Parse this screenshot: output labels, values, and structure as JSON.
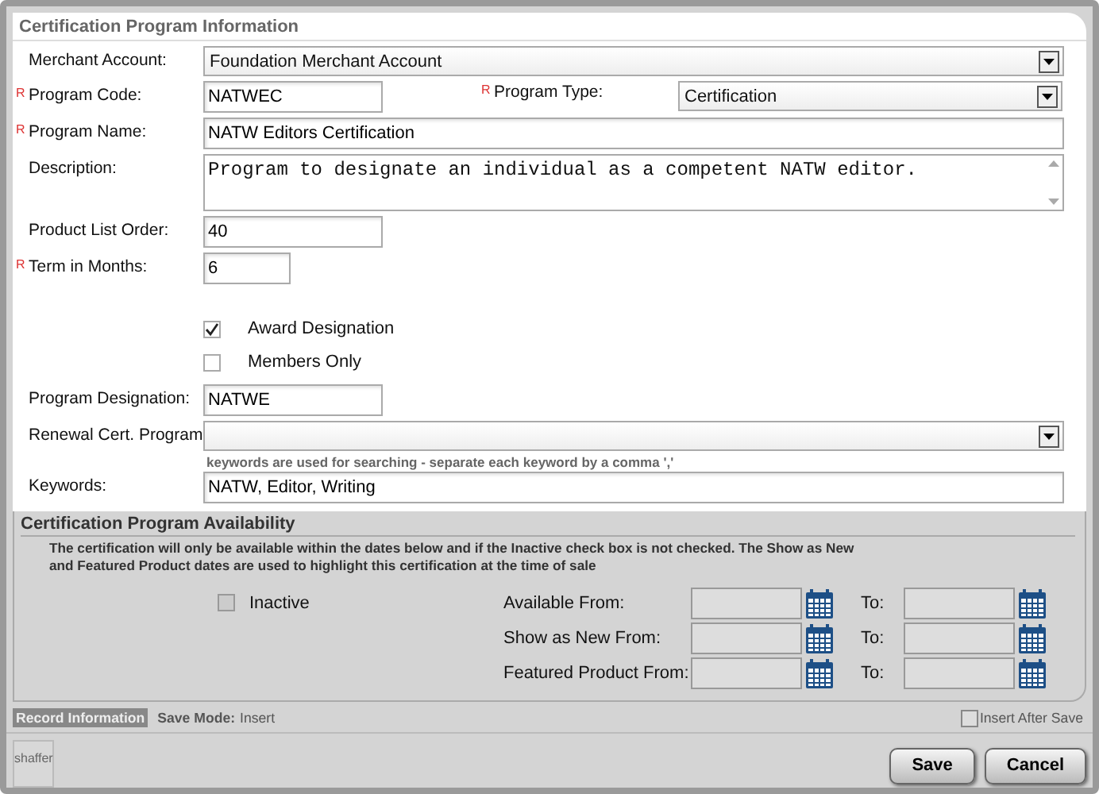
{
  "info": {
    "title": "Certification Program Information",
    "merchant_account": {
      "label": "Merchant Account:",
      "value": "Foundation Merchant Account"
    },
    "program_code": {
      "label": "Program Code:",
      "required_mark": "R",
      "value": "NATWEC"
    },
    "program_type": {
      "label": "Program Type:",
      "required_mark": "R",
      "value": "Certification"
    },
    "program_name": {
      "label": "Program Name:",
      "required_mark": "R",
      "value": "NATW Editors Certification"
    },
    "description": {
      "label": "Description:",
      "value": "Program to designate an individual as a competent NATW editor."
    },
    "product_list_order": {
      "label": "Product List Order:",
      "value": "40"
    },
    "term_in_months": {
      "label": "Term in Months:",
      "required_mark": "R",
      "value": "6"
    },
    "options": [
      {
        "label": "Award Designation",
        "checked": true
      },
      {
        "label": "Members Only",
        "checked": false
      }
    ],
    "program_designation": {
      "label": "Program Designation:",
      "value": "NATWE"
    },
    "renewal_cert_program": {
      "label": "Renewal Cert. Program"
    },
    "keywords_hint": "keywords are used for searching - separate each keyword by a comma ','",
    "keywords": {
      "label": "Keywords:",
      "value": "NATW, Editor, Writing"
    }
  },
  "availability": {
    "title": "Certification Program Availability",
    "note": "The certification will only be available within the dates below and if the Inactive check box is not checked. The Show as New and Featured Product dates are used to highlight this certification at the time of sale",
    "inactive": {
      "label": "Inactive",
      "checked": false
    },
    "date_rows": [
      {
        "label": "Available From:",
        "to_label": "To:"
      },
      {
        "label": "Show as New From:",
        "to_label": "To:"
      },
      {
        "label": "Featured Product From:",
        "to_label": "To:"
      }
    ]
  },
  "footer": {
    "record_tab": "Record Information",
    "save_mode_label": "Save Mode:",
    "save_mode_value": "Insert",
    "insert_after_save": {
      "label": "Insert After Save",
      "checked": false
    },
    "user": "shaffer",
    "buttons": [
      "Save",
      "Cancel"
    ]
  }
}
